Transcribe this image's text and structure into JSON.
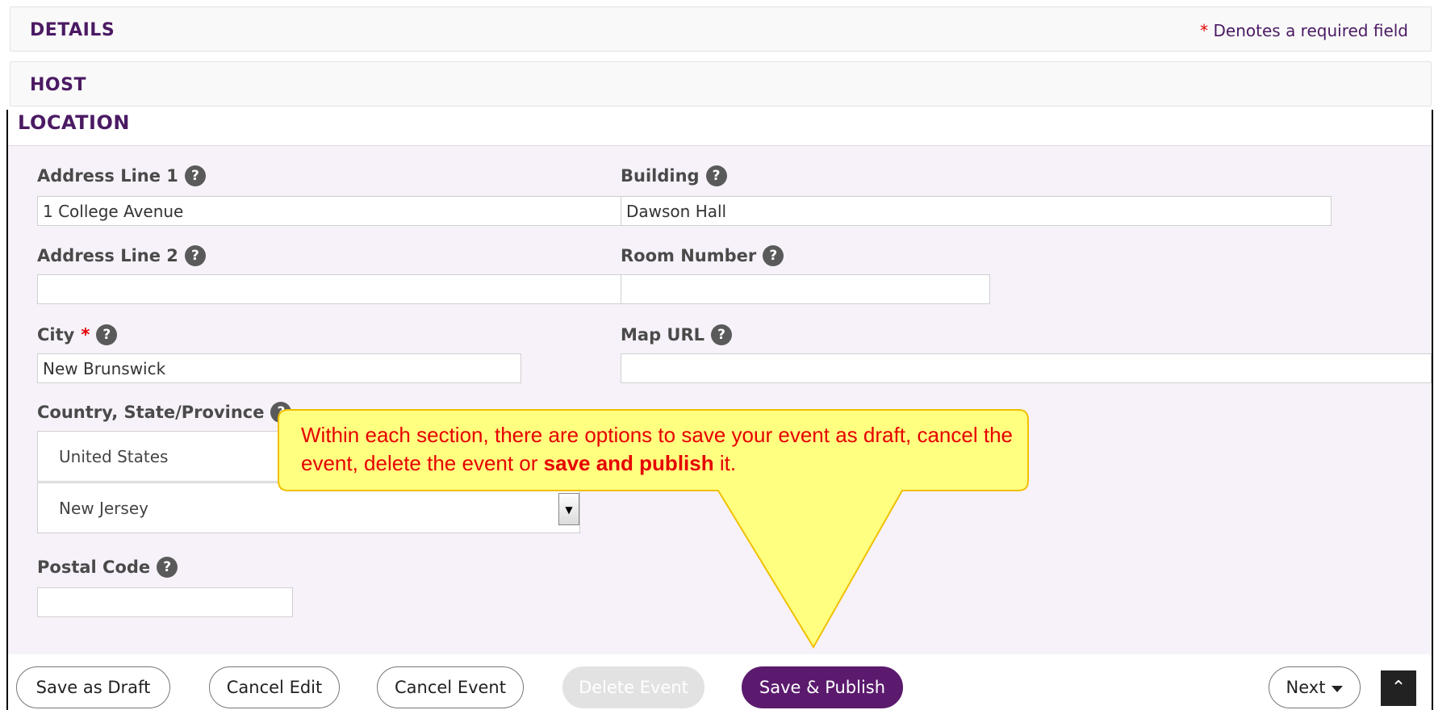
{
  "sections": {
    "details": "DETAILS",
    "host": "HOST",
    "location": "LOCATION",
    "required_star": "*",
    "required_note": "Denotes a required field"
  },
  "fields": {
    "address1": {
      "label": "Address Line 1",
      "value": "1 College Avenue"
    },
    "building": {
      "label": "Building",
      "value": "Dawson Hall"
    },
    "address2": {
      "label": "Address Line 2",
      "value": ""
    },
    "room": {
      "label": "Room Number",
      "value": ""
    },
    "city": {
      "label": "City",
      "required": "*",
      "value": "New Brunswick"
    },
    "map_url": {
      "label": "Map URL",
      "value": ""
    },
    "country_state": {
      "label": "Country, State/Province",
      "country": "United States",
      "state": "New Jersey"
    },
    "postal": {
      "label": "Postal Code",
      "value": ""
    }
  },
  "help_icon": {
    "glyph": "?",
    "icon": "question-circle-icon"
  },
  "buttons": {
    "save_draft": "Save as Draft",
    "cancel_edit": "Cancel Edit",
    "cancel_event": "Cancel Event",
    "delete_event": "Delete Event",
    "save_publish": "Save & Publish",
    "next": "Next"
  },
  "callout": {
    "text_before": "Within each section, there are options to save your event as draft, cancel the event, delete the event or ",
    "text_bold": "save and publish",
    "text_after": " it."
  },
  "colors": {
    "brand_purple": "#4b1a63",
    "primary_button": "#5b1a6e",
    "required_red": "#e60000",
    "callout_fill": "#ffff80",
    "callout_border": "#f0c000"
  }
}
